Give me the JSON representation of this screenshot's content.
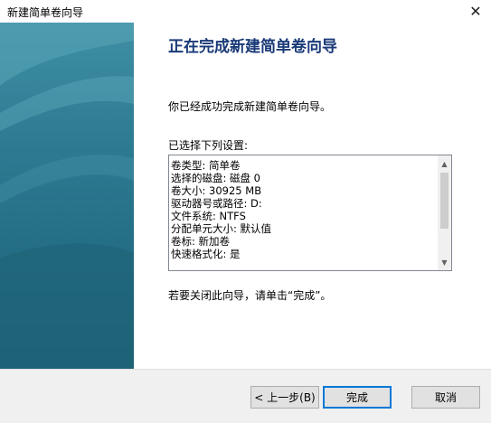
{
  "window": {
    "title": "新建简单卷向导",
    "close_label": "✕"
  },
  "main": {
    "heading": "正在完成新建简单卷向导",
    "message": "你已经成功完成新建简单卷向导。",
    "selected_label": "已选择下列设置:",
    "settings": [
      "卷类型: 简单卷",
      "选择的磁盘: 磁盘 0",
      "卷大小: 30925 MB",
      "驱动器号或路径: D:",
      "文件系统: NTFS",
      "分配单元大小: 默认值",
      "卷标: 新加卷",
      "快速格式化: 是"
    ],
    "close_hint": "若要关闭此向导，请单击“完成”。"
  },
  "buttons": {
    "back": "< 上一步(B)",
    "finish": "完成",
    "cancel": "取消"
  },
  "icons": {
    "scroll_up": "chevron-up-icon",
    "scroll_down": "chevron-down-icon"
  },
  "colors": {
    "heading": "#1a3a78",
    "banner": "#2d7b92",
    "default_button_border": "#0078d7"
  }
}
